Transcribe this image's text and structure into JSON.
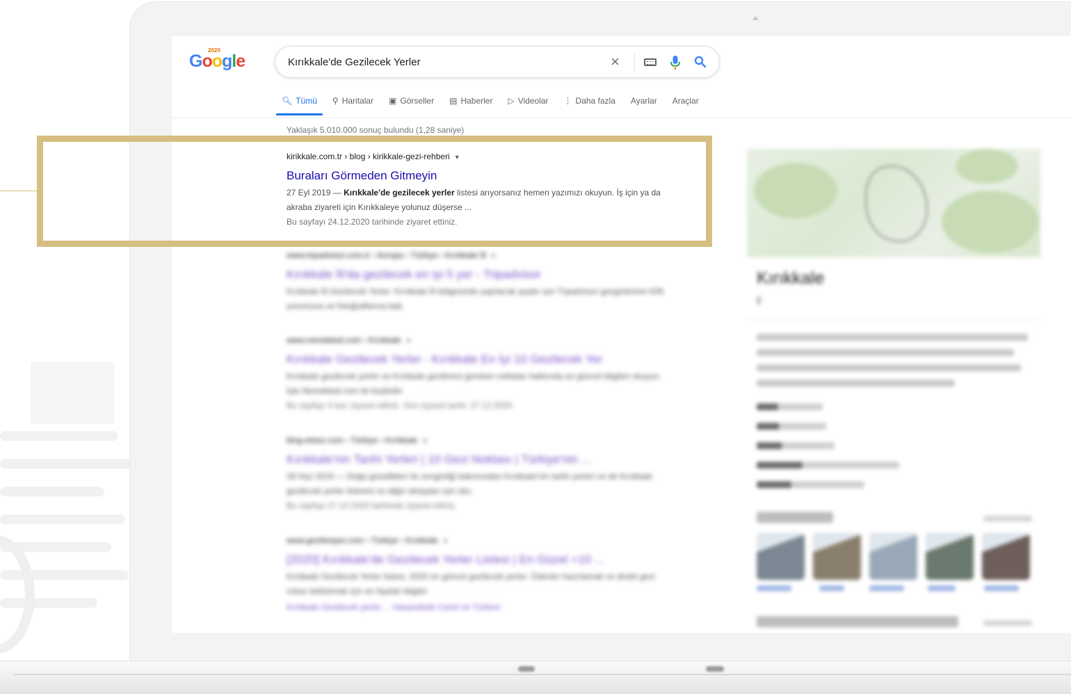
{
  "search": {
    "logo_letters": [
      {
        "char": "G",
        "color": "#4285f4"
      },
      {
        "char": "o",
        "color": "#ea4335"
      },
      {
        "char": "o",
        "color": "#fbbc05"
      },
      {
        "char": "g",
        "color": "#4285f4"
      },
      {
        "char": "l",
        "color": "#34a853"
      },
      {
        "char": "e",
        "color": "#ea4335"
      }
    ],
    "logo_badge": "2020",
    "query": "Kırıkkale'de Gezilecek Yerler",
    "clear_glyph": "×"
  },
  "tabs": [
    {
      "icon": "search-icon",
      "glyph": "🔍︎",
      "label": "Tümü",
      "active": true
    },
    {
      "icon": "map-pin-icon",
      "glyph": "⚲",
      "label": "Haritalar"
    },
    {
      "icon": "image-icon",
      "glyph": "▣",
      "label": "Görseller"
    },
    {
      "icon": "news-icon",
      "glyph": "▤",
      "label": "Haberler"
    },
    {
      "icon": "video-icon",
      "glyph": "▷",
      "label": "Videolar"
    },
    {
      "icon": "more-vert-icon",
      "glyph": "⋮",
      "label": "Daha fazla"
    },
    {
      "label": "Ayarlar"
    },
    {
      "label": "Araçlar"
    }
  ],
  "stats": "Yaklaşık 5.010.000 sonuç bulundu (1,28 saniye)",
  "results": [
    {
      "cite": "kirikkale.com.tr › blog › kirikkale-gezi-rehberi",
      "title": "Buraları Görmeden Gitmeyin",
      "snippet_pre": "27 Eyl 2019 — ",
      "snippet_bold": "Kırıkkale'de gezilecek yerler",
      "snippet_post": " listesi arıyorsanız hemen yazımızı okuyun. İş için ya da akraba ziyareti için Kırıkkaleye yolunuz düşerse ...",
      "visited": "Bu sayfayı 24.12.2020 tarihinde ziyaret ettiniz."
    },
    {
      "cite": "www.tripadvisor.com.tr › Avrupa › Türkiye › Kırıkkale İli",
      "title": "Kırıkkale İli'da gezilecek en iyi 5 yer - Tripadvisor",
      "snippet": "Kırıkkale İli Gezilecek Yerler: Kırıkkale İli bölgesinde yapılacak şeyler için Tripadvisor gezginlerinin 636 yorumuna ve fotoğraflarına bak."
    },
    {
      "cite": "www.neredekal.com › Kırıkkale",
      "title": "Kırıkkale Gezilecek Yerler - Kırıkkale En İyi 10 Gezilecek Yer",
      "snippet": "Kırıkkale gezilecek yerler ve Kırıkkale gezilmesi gereken noktalar hakkında en güncel bilgileri okuyun. İşte Neredekal.com ile keşfedin",
      "visited": "Bu sayfayı 4 kez ziyaret ettiniz. Son ziyaret tarihi: 27.12.2020"
    },
    {
      "cite": "blog.etstur.com › Türkiye › Kırıkkale",
      "title": "Kırıkkale'nin Tarihi Yerleri | 10 Gezi Noktası | Türkiye'nin ...",
      "snippet": "29 Haz 2019 — Doğa güzellikleri ile zenginliği bakımından Kırıkkale'nin tarihi yerleri ve de Kırıkkale gezilecek yerler listesini ve diğer detayları için oku",
      "visited": "Bu sayfayı 27.12.2020 tarihinde ziyaret ettiniz."
    },
    {
      "cite": "www.gezilesiyer.com › Türkiye › Kırıkkale",
      "title": "[2020] Kırıkkale'de Gezilecek Yerler Listesi | En Güzel +10 ...",
      "snippet": "Kırıkkale Gezilecek Yerler listesi, 2020 en güncel gezilecek yerler. Ödevler hazırlamak ve direkt gezi rotası belirlemek için en faydalı bilgiler",
      "links": "Kırıkkale Gezilecek yerler ... Hasandede Camii ve Türbesi"
    }
  ],
  "panel": {
    "title": "Kırıkkale",
    "thumb_colors": [
      "#7b8792",
      "#8a7f6c",
      "#9aa9b8",
      "#6b7a6e",
      "#6e5f5a"
    ]
  }
}
